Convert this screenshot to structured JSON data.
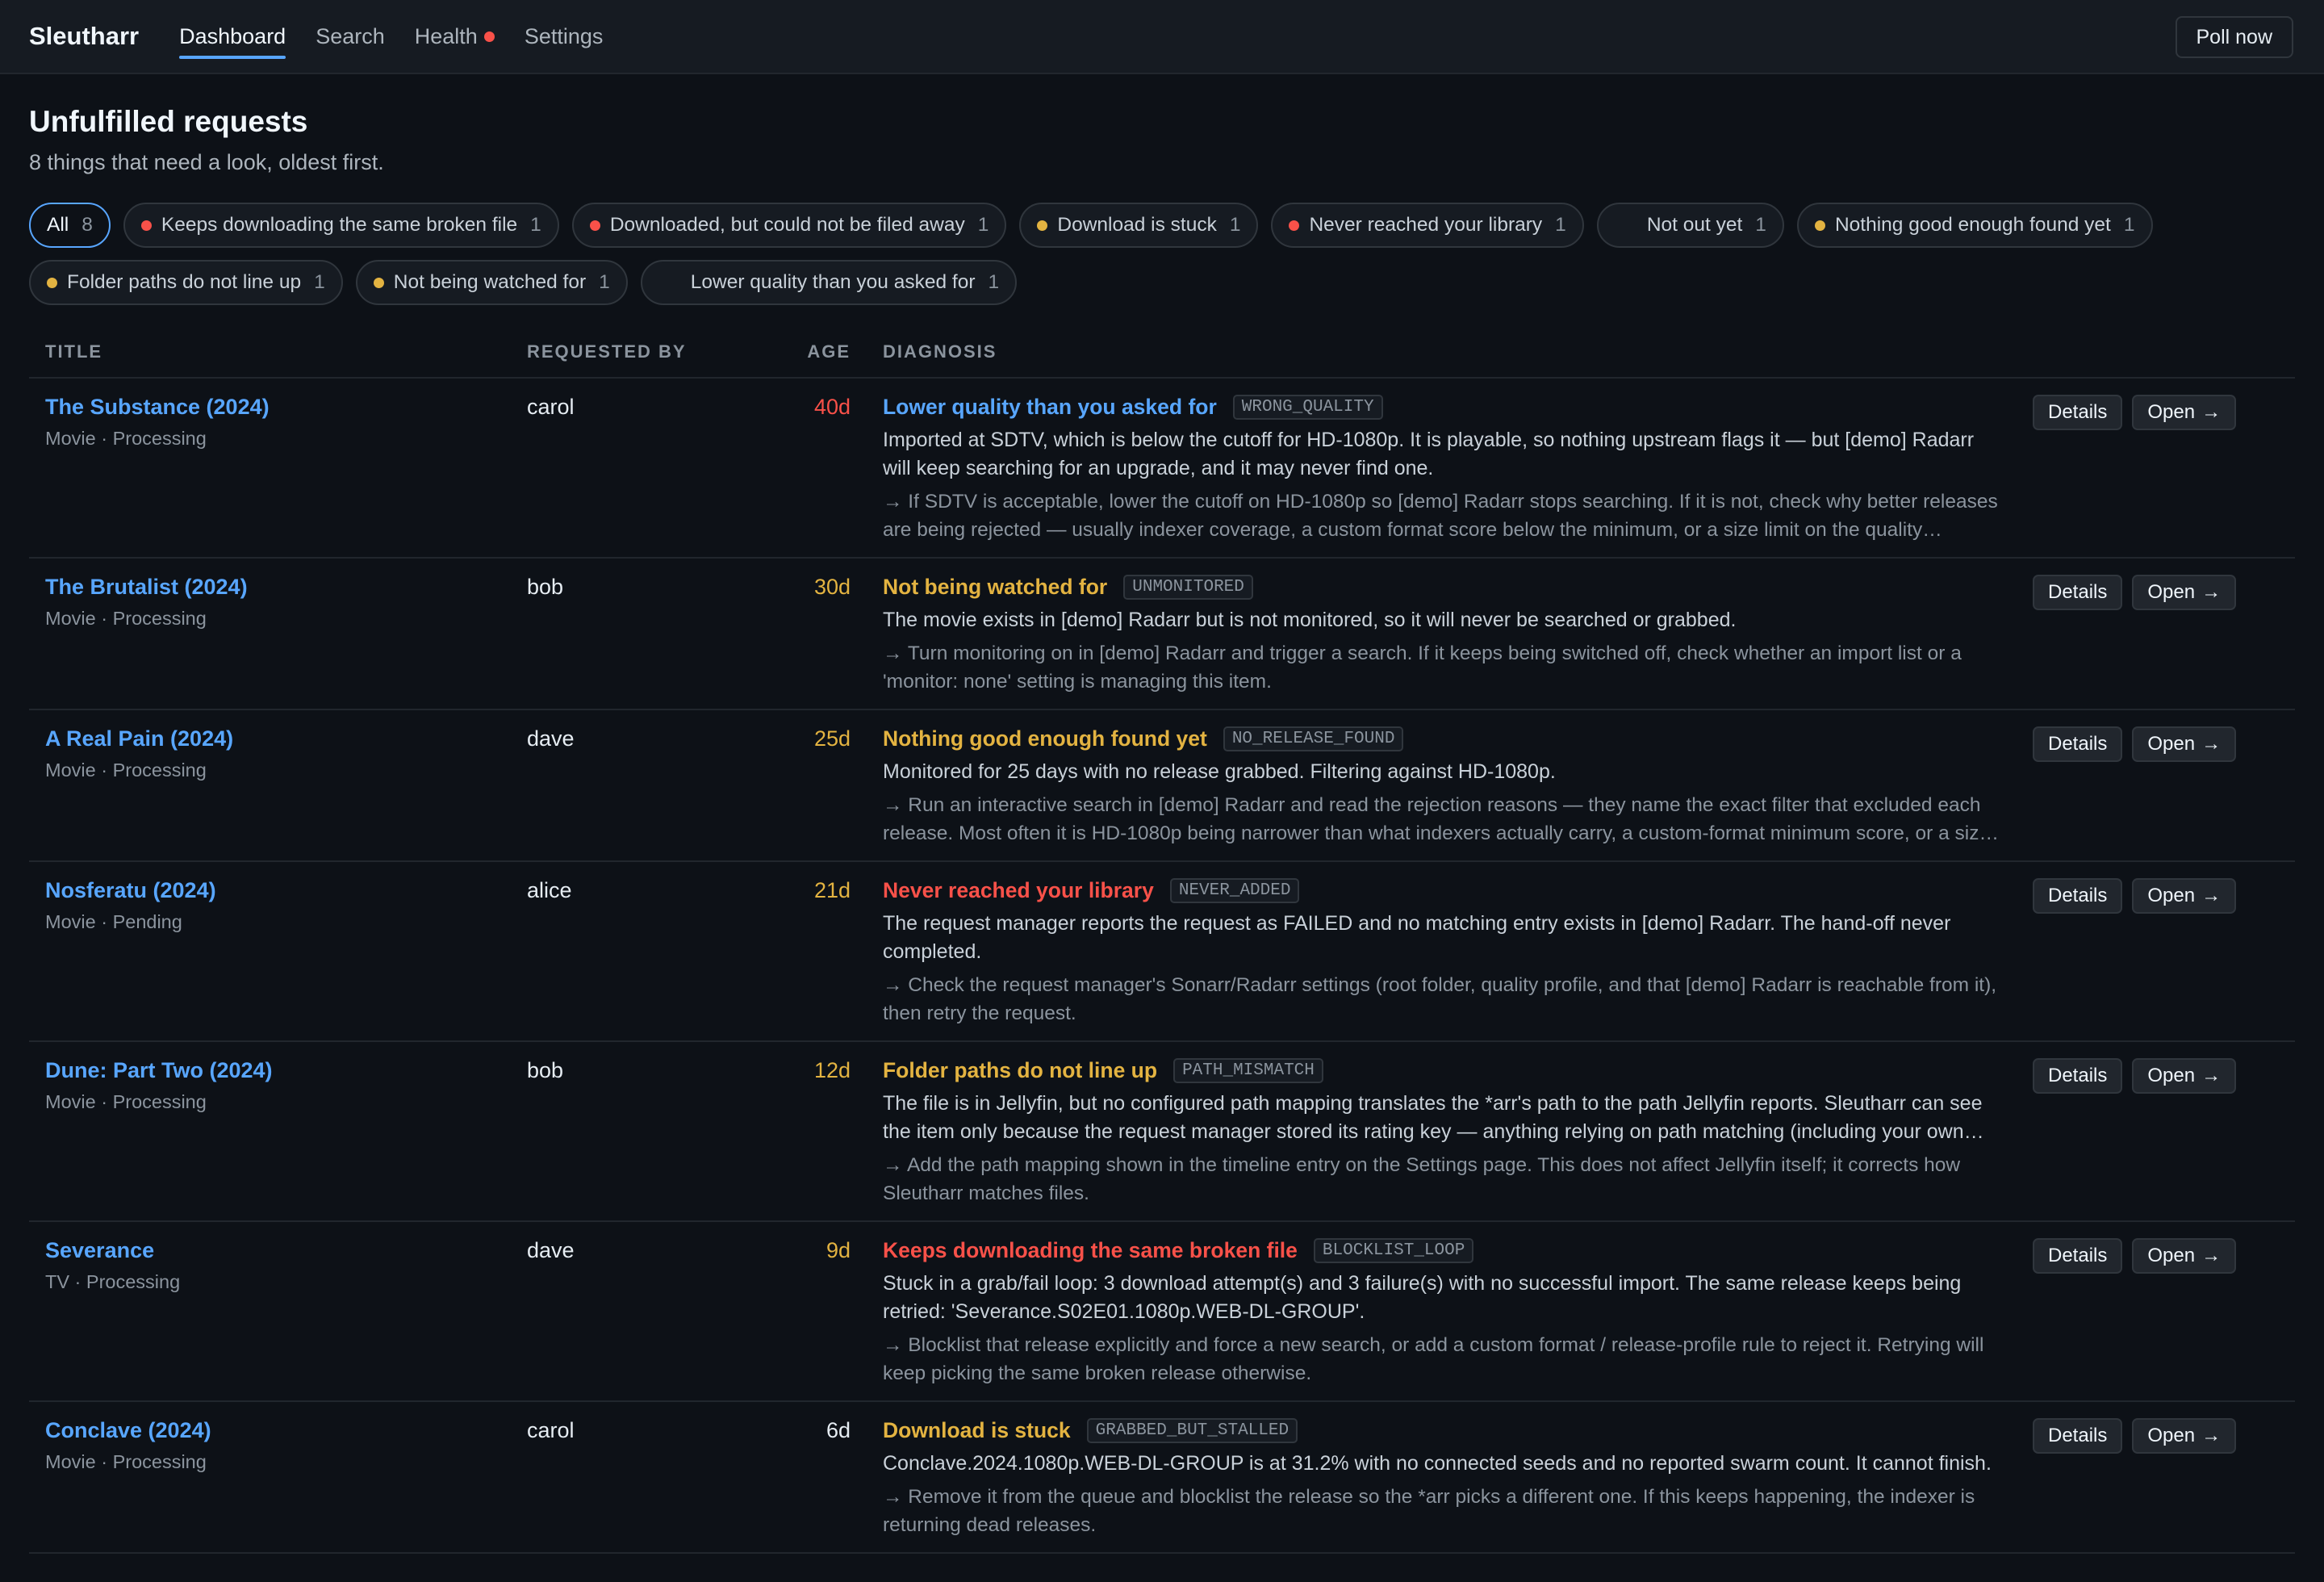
{
  "app": {
    "name": "Sleutharr",
    "nav": [
      {
        "label": "Dashboard"
      },
      {
        "label": "Search"
      },
      {
        "label": "Health"
      },
      {
        "label": "Settings"
      }
    ],
    "poll_label": "Poll now"
  },
  "page": {
    "title": "Unfulfilled requests",
    "subtitle": "8 things that need a look, oldest first."
  },
  "filters": [
    {
      "label": "All",
      "count": "8"
    },
    {
      "label": "Keeps downloading the same broken file",
      "count": "1",
      "dot": "red"
    },
    {
      "label": "Downloaded, but could not be filed away",
      "count": "1",
      "dot": "red"
    },
    {
      "label": "Download is stuck",
      "count": "1",
      "dot": "amber"
    },
    {
      "label": "Never reached your library",
      "count": "1",
      "dot": "red"
    },
    {
      "label": "Not out yet",
      "count": "1",
      "dot": "none"
    },
    {
      "label": "Nothing good enough found yet",
      "count": "1",
      "dot": "amber"
    },
    {
      "label": "Folder paths do not line up",
      "count": "1",
      "dot": "amber"
    },
    {
      "label": "Not being watched for",
      "count": "1",
      "dot": "amber"
    },
    {
      "label": "Lower quality than you asked for",
      "count": "1",
      "dot": "none"
    }
  ],
  "table": {
    "headers": {
      "title": "TITLE",
      "requested_by": "REQUESTED BY",
      "age": "AGE",
      "diagnosis": "DIAGNOSIS"
    },
    "details_label": "Details",
    "open_label": "Open",
    "rows": [
      {
        "title": "The Substance (2024)",
        "meta": "Movie · Processing",
        "requester": "carol",
        "age": "40d",
        "age_color": "red",
        "diag_title": "Lower quality than you asked for",
        "diag_color": "blue",
        "code": "WRONG_QUALITY",
        "body": "Imported at SDTV, which is below the cutoff for HD-1080p. It is playable, so nothing upstream flags it — but [demo] Radarr will keep searching for an upgrade, and it may never find one.",
        "hint": "→ If SDTV is acceptable, lower the cutoff on HD-1080p so [demo] Radarr stops searching. If it is not, check why better releases are being rejected — usually indexer coverage, a custom format score below the minimum, or a size limit on the quality definition."
      },
      {
        "title": "The Brutalist (2024)",
        "meta": "Movie · Processing",
        "requester": "bob",
        "age": "30d",
        "age_color": "amber",
        "diag_title": "Not being watched for",
        "diag_color": "amber",
        "code": "UNMONITORED",
        "body": "The movie exists in [demo] Radarr but is not monitored, so it will never be searched or grabbed.",
        "hint": "→ Turn monitoring on in [demo] Radarr and trigger a search. If it keeps being switched off, check whether an import list or a 'monitor: none' setting is managing this item."
      },
      {
        "title": "A Real Pain (2024)",
        "meta": "Movie · Processing",
        "requester": "dave",
        "age": "25d",
        "age_color": "amber",
        "diag_title": "Nothing good enough found yet",
        "diag_color": "amber",
        "code": "NO_RELEASE_FOUND",
        "body": "Monitored for 25 days with no release grabbed. Filtering against HD-1080p.",
        "hint": "→ Run an interactive search in [demo] Radarr and read the rejection reasons — they name the exact filter that excluded each release. Most often it is HD-1080p being narrower than what indexers actually carry, a custom-format minimum score, or a size limit."
      },
      {
        "title": "Nosferatu (2024)",
        "meta": "Movie · Pending",
        "requester": "alice",
        "age": "21d",
        "age_color": "amber",
        "diag_title": "Never reached your library",
        "diag_color": "red",
        "code": "NEVER_ADDED",
        "body": "The request manager reports the request as FAILED and no matching entry exists in [demo] Radarr. The hand-off never completed.",
        "hint": "→ Check the request manager's Sonarr/Radarr settings (root folder, quality profile, and that [demo] Radarr is reachable from it), then retry the request."
      },
      {
        "title": "Dune: Part Two (2024)",
        "meta": "Movie · Processing",
        "requester": "bob",
        "age": "12d",
        "age_color": "amber",
        "diag_title": "Folder paths do not line up",
        "diag_color": "amber",
        "code": "PATH_MISMATCH",
        "body": "The file is in Jellyfin, but no configured path mapping translates the *arr's path to the path Jellyfin reports. Sleutharr can see the item only because the request manager stored its rating key — anything relying on path matching (including your own scripts) will miss it.",
        "hint": "→ Add the path mapping shown in the timeline entry on the Settings page. This does not affect Jellyfin itself; it corrects how Sleutharr matches files."
      },
      {
        "title": "Severance",
        "meta": "TV · Processing",
        "requester": "dave",
        "age": "9d",
        "age_color": "amber",
        "diag_title": "Keeps downloading the same broken file",
        "diag_color": "red",
        "code": "BLOCKLIST_LOOP",
        "body": "Stuck in a grab/fail loop: 3 download attempt(s) and 3 failure(s) with no successful import. The same release keeps being retried: 'Severance.S02E01.1080p.WEB-DL-GROUP'.",
        "hint": "→ Blocklist that release explicitly and force a new search, or add a custom format / release-profile rule to reject it. Retrying will keep picking the same broken release otherwise."
      },
      {
        "title": "Conclave (2024)",
        "meta": "Movie · Processing",
        "requester": "carol",
        "age": "6d",
        "age_color": "white",
        "diag_title": "Download is stuck",
        "diag_color": "amber",
        "code": "GRABBED_BUT_STALLED",
        "body": "Conclave.2024.1080p.WEB-DL-GROUP is at 31.2% with no connected seeds and no reported swarm count. It cannot finish.",
        "hint": "→ Remove it from the queue and blocklist the release so the *arr picks a different one. If this keeps happening, the indexer is returning dead releases."
      }
    ]
  }
}
